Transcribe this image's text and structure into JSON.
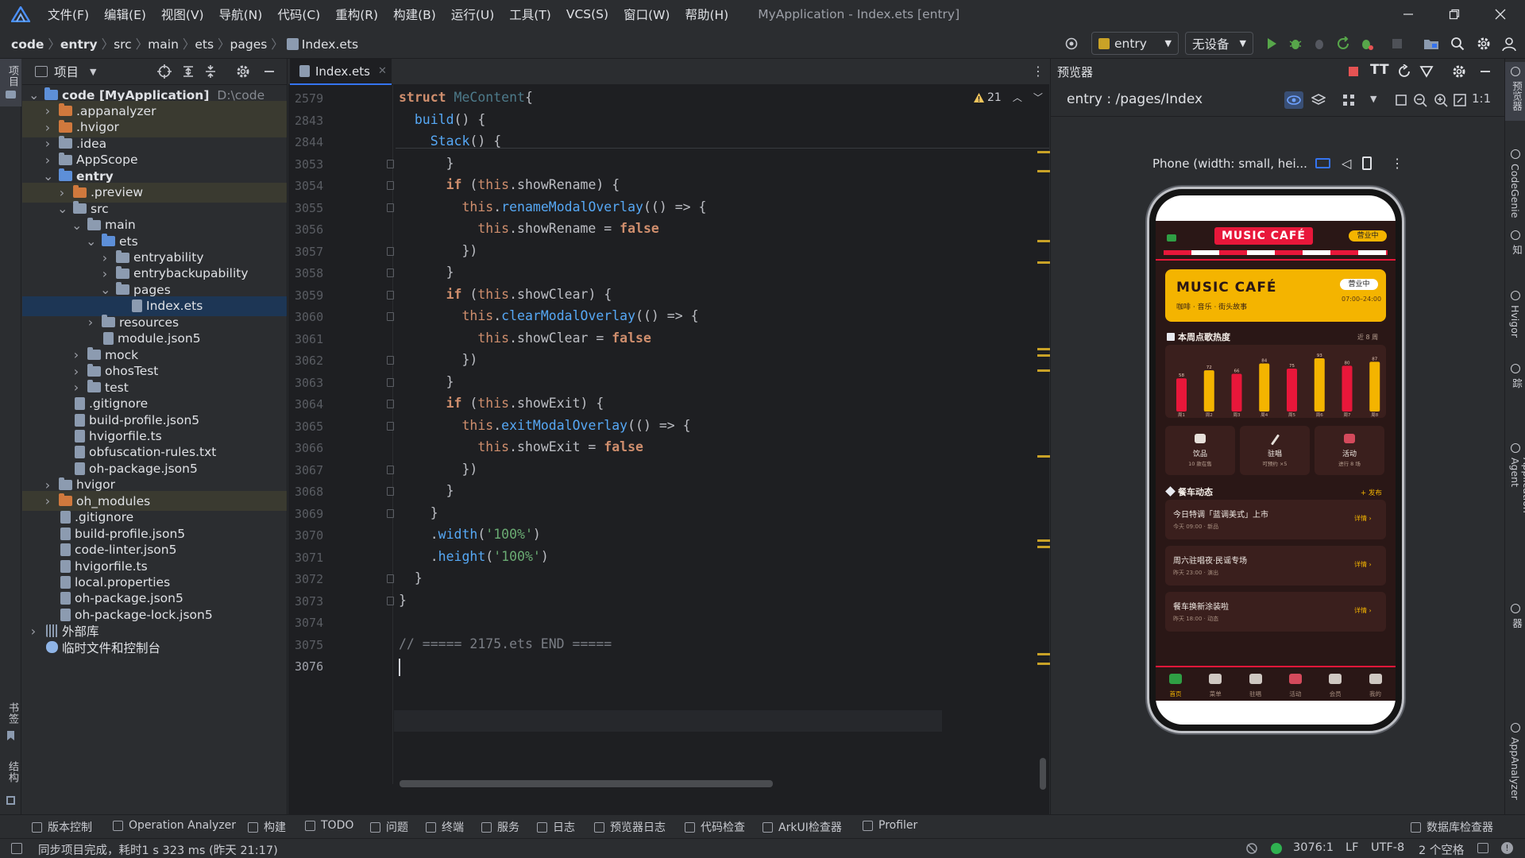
{
  "menubar": {
    "items": [
      "文件(F)",
      "编辑(E)",
      "视图(V)",
      "导航(N)",
      "代码(C)",
      "重构(R)",
      "构建(B)",
      "运行(U)",
      "工具(T)",
      "VCS(S)",
      "窗口(W)",
      "帮助(H)"
    ],
    "window_title": "MyApplication - Index.ets [entry]"
  },
  "breadcrumb": [
    "code",
    "entry",
    "src",
    "main",
    "ets",
    "pages",
    "Index.ets"
  ],
  "toolbar": {
    "run_config": "entry",
    "device": "无设备"
  },
  "left_strip": {
    "project_label": "项目",
    "bookmarks_label": "书签",
    "structure_label": "结构"
  },
  "project_panel": {
    "title": "项目",
    "tree": [
      {
        "depth": 0,
        "label": "code [MyApplication]",
        "hint": "D:\\code",
        "kind": "folder-blue",
        "chev": "v",
        "bold": true
      },
      {
        "depth": 1,
        "label": ".appanalyzer",
        "kind": "folder-orange",
        "chev": ">",
        "hl": true
      },
      {
        "depth": 1,
        "label": ".hvigor",
        "kind": "folder-orange",
        "chev": ">",
        "hl": true
      },
      {
        "depth": 1,
        "label": ".idea",
        "kind": "folder",
        "chev": ">"
      },
      {
        "depth": 1,
        "label": "AppScope",
        "kind": "folder",
        "chev": ">"
      },
      {
        "depth": 1,
        "label": "entry",
        "kind": "folder-blue",
        "chev": "v",
        "bold": true
      },
      {
        "depth": 2,
        "label": ".preview",
        "kind": "folder-orange",
        "chev": ">",
        "hl": true
      },
      {
        "depth": 2,
        "label": "src",
        "kind": "folder",
        "chev": "v"
      },
      {
        "depth": 3,
        "label": "main",
        "kind": "folder",
        "chev": "v"
      },
      {
        "depth": 4,
        "label": "ets",
        "kind": "folder-blue",
        "chev": "v"
      },
      {
        "depth": 5,
        "label": "entryability",
        "kind": "folder",
        "chev": ">"
      },
      {
        "depth": 5,
        "label": "entrybackupability",
        "kind": "folder",
        "chev": ">"
      },
      {
        "depth": 5,
        "label": "pages",
        "kind": "folder",
        "chev": "v"
      },
      {
        "depth": 6,
        "label": "Index.ets",
        "kind": "file",
        "chev": "",
        "sel": true
      },
      {
        "depth": 4,
        "label": "resources",
        "kind": "folder",
        "chev": ">"
      },
      {
        "depth": 4,
        "label": "module.json5",
        "kind": "file",
        "chev": ""
      },
      {
        "depth": 3,
        "label": "mock",
        "kind": "folder",
        "chev": ">"
      },
      {
        "depth": 3,
        "label": "ohosTest",
        "kind": "folder",
        "chev": ">"
      },
      {
        "depth": 3,
        "label": "test",
        "kind": "folder",
        "chev": ">"
      },
      {
        "depth": 2,
        "label": ".gitignore",
        "kind": "file",
        "chev": ""
      },
      {
        "depth": 2,
        "label": "build-profile.json5",
        "kind": "file",
        "chev": ""
      },
      {
        "depth": 2,
        "label": "hvigorfile.ts",
        "kind": "file",
        "chev": ""
      },
      {
        "depth": 2,
        "label": "obfuscation-rules.txt",
        "kind": "file",
        "chev": ""
      },
      {
        "depth": 2,
        "label": "oh-package.json5",
        "kind": "file",
        "chev": ""
      },
      {
        "depth": 1,
        "label": "hvigor",
        "kind": "folder",
        "chev": ">"
      },
      {
        "depth": 1,
        "label": "oh_modules",
        "kind": "folder-orange",
        "chev": ">",
        "hl": true
      },
      {
        "depth": 1,
        "label": ".gitignore",
        "kind": "file",
        "chev": ""
      },
      {
        "depth": 1,
        "label": "build-profile.json5",
        "kind": "file",
        "chev": ""
      },
      {
        "depth": 1,
        "label": "code-linter.json5",
        "kind": "file",
        "chev": ""
      },
      {
        "depth": 1,
        "label": "hvigorfile.ts",
        "kind": "file",
        "chev": ""
      },
      {
        "depth": 1,
        "label": "local.properties",
        "kind": "file",
        "chev": ""
      },
      {
        "depth": 1,
        "label": "oh-package.json5",
        "kind": "file",
        "chev": ""
      },
      {
        "depth": 1,
        "label": "oh-package-lock.json5",
        "kind": "file",
        "chev": ""
      },
      {
        "depth": 0,
        "label": "外部库",
        "kind": "lib",
        "chev": ">"
      },
      {
        "depth": 0,
        "label": "临时文件和控制台",
        "kind": "scratch",
        "chev": ""
      }
    ]
  },
  "editor": {
    "tab": "Index.ets",
    "warnings": "21",
    "lines": [
      {
        "n": "2579",
        "code": [
          [
            "kw",
            "struct "
          ],
          [
            "ty",
            "MeContent"
          ],
          [
            "",
            "{"
          ]
        ]
      },
      {
        "n": "2843",
        "code": [
          [
            "",
            "  "
          ],
          [
            "fn",
            "build"
          ],
          [
            "",
            "() {"
          ]
        ]
      },
      {
        "n": "2844",
        "code": [
          [
            "",
            "    "
          ],
          [
            "fn",
            "Stack"
          ],
          [
            "",
            "() {"
          ]
        ]
      },
      {
        "n": "3053",
        "code": [
          [
            "",
            "      }"
          ]
        ]
      },
      {
        "n": "3054",
        "code": [
          [
            "",
            "      "
          ],
          [
            "kw",
            "if "
          ],
          [
            "",
            "("
          ],
          [
            "this",
            "this"
          ],
          [
            "",
            ".showRename) {"
          ]
        ]
      },
      {
        "n": "3055",
        "code": [
          [
            "",
            "        "
          ],
          [
            "this",
            "this"
          ],
          [
            "",
            "."
          ],
          [
            "fn",
            "renameModalOverlay"
          ],
          [
            "",
            "(() => {"
          ]
        ]
      },
      {
        "n": "3056",
        "code": [
          [
            "",
            "          "
          ],
          [
            "this",
            "this"
          ],
          [
            "",
            ".showRename = "
          ],
          [
            "kw",
            "false"
          ]
        ]
      },
      {
        "n": "3057",
        "code": [
          [
            "",
            "        })"
          ]
        ]
      },
      {
        "n": "3058",
        "code": [
          [
            "",
            "      }"
          ]
        ]
      },
      {
        "n": "3059",
        "code": [
          [
            "",
            "      "
          ],
          [
            "kw",
            "if "
          ],
          [
            "",
            "("
          ],
          [
            "this",
            "this"
          ],
          [
            "",
            ".showClear) {"
          ]
        ]
      },
      {
        "n": "3060",
        "code": [
          [
            "",
            "        "
          ],
          [
            "this",
            "this"
          ],
          [
            "",
            "."
          ],
          [
            "fn",
            "clearModalOverlay"
          ],
          [
            "",
            "(() => {"
          ]
        ]
      },
      {
        "n": "3061",
        "code": [
          [
            "",
            "          "
          ],
          [
            "this",
            "this"
          ],
          [
            "",
            ".showClear = "
          ],
          [
            "kw",
            "false"
          ]
        ]
      },
      {
        "n": "3062",
        "code": [
          [
            "",
            "        })"
          ]
        ]
      },
      {
        "n": "3063",
        "code": [
          [
            "",
            "      }"
          ]
        ]
      },
      {
        "n": "3064",
        "code": [
          [
            "",
            "      "
          ],
          [
            "kw",
            "if "
          ],
          [
            "",
            "("
          ],
          [
            "this",
            "this"
          ],
          [
            "",
            ".showExit) {"
          ]
        ]
      },
      {
        "n": "3065",
        "code": [
          [
            "",
            "        "
          ],
          [
            "this",
            "this"
          ],
          [
            "",
            "."
          ],
          [
            "fn",
            "exitModalOverlay"
          ],
          [
            "",
            "(() => {"
          ]
        ]
      },
      {
        "n": "3066",
        "code": [
          [
            "",
            "          "
          ],
          [
            "this",
            "this"
          ],
          [
            "",
            ".showExit = "
          ],
          [
            "kw",
            "false"
          ]
        ]
      },
      {
        "n": "3067",
        "code": [
          [
            "",
            "        })"
          ]
        ]
      },
      {
        "n": "3068",
        "code": [
          [
            "",
            "      }"
          ]
        ]
      },
      {
        "n": "3069",
        "code": [
          [
            "",
            "    }"
          ]
        ]
      },
      {
        "n": "3070",
        "code": [
          [
            "",
            "    ."
          ],
          [
            "fn",
            "width"
          ],
          [
            "",
            "("
          ],
          [
            "str",
            "'100%'"
          ],
          [
            "",
            ")"
          ]
        ]
      },
      {
        "n": "3071",
        "code": [
          [
            "",
            "    ."
          ],
          [
            "fn",
            "height"
          ],
          [
            "",
            "("
          ],
          [
            "str",
            "'100%'"
          ],
          [
            "",
            ")"
          ]
        ]
      },
      {
        "n": "3072",
        "code": [
          [
            "",
            "  }"
          ]
        ]
      },
      {
        "n": "3073",
        "code": [
          [
            "",
            "}"
          ]
        ]
      },
      {
        "n": "3074",
        "code": [
          [
            "",
            ""
          ]
        ]
      },
      {
        "n": "3075",
        "code": [
          [
            "cm",
            "// ===== 2175.ets END ====="
          ]
        ]
      },
      {
        "n": "3076",
        "code": [
          [
            "",
            ""
          ]
        ]
      }
    ]
  },
  "preview_panel": {
    "title": "预览器",
    "route": "entry : /pages/Index",
    "device_label": "Phone (width: small, hei..."
  },
  "phone_app": {
    "top_badge": "MUSIC CAFÉ",
    "top_status": "营业中",
    "card_title": "MUSIC CAFÉ",
    "card_subtitle": "咖啡 · 音乐 · 街头故事",
    "card_status": "营业中",
    "card_hours": "07:00–24:00",
    "chart_title": "本周点歌热度",
    "chart_range": "近 8 周",
    "chart_data": {
      "type": "bar",
      "title": "本周点歌热度",
      "categories": [
        "周1",
        "周2",
        "周3",
        "周4",
        "周5",
        "周6",
        "周7",
        "周8"
      ],
      "values": [
        58,
        72,
        66,
        84,
        75,
        93,
        80,
        87
      ],
      "colors": [
        "#e8173a",
        "#f4b400"
      ],
      "ylim": [
        0,
        100
      ]
    },
    "quick": [
      {
        "label": "饮品",
        "sub": "10 款在售"
      },
      {
        "label": "驻唱",
        "sub": "可预约 ×5"
      },
      {
        "label": "活动",
        "sub": "进行 8 场"
      }
    ],
    "news_title": "餐车动态",
    "news_action": "+ 发布",
    "news": [
      {
        "title": "今日特调「蓝调美式」上市",
        "meta": "今天 09:00 · 新品",
        "action": "详情 ›"
      },
      {
        "title": "周六驻唱夜·民谣专场",
        "meta": "昨天 23:00 · 演出",
        "action": "详情 ›"
      },
      {
        "title": "餐车换新涂装啦",
        "meta": "昨天 18:00 · 动态",
        "action": "详情 ›"
      }
    ],
    "tabs": [
      "首页",
      "菜单",
      "驻唱",
      "活动",
      "会员",
      "我的"
    ]
  },
  "right_strip": [
    "预览器",
    "CodeGenie",
    "通知",
    "Hvigor",
    "问题追踪",
    "Application Agent",
    "设备文件浏览器",
    "AppAnalyzer"
  ],
  "tool_windows": [
    "版本控制",
    "Operation Analyzer",
    "构建",
    "TODO",
    "问题",
    "终端",
    "服务",
    "日志",
    "预览器日志",
    "代码检查",
    "ArkUI检查器",
    "Profiler",
    "数据库检查器"
  ],
  "status": {
    "message": "同步项目完成，耗时1 s 323 ms (昨天 21:17)",
    "position": "3076:1",
    "line_sep": "LF",
    "encoding": "UTF-8",
    "indent": "2 个空格"
  },
  "colors": {
    "accent": "#3574f0",
    "red": "#e8173a",
    "yellow": "#f4b400",
    "bg": "#1e1f22"
  }
}
